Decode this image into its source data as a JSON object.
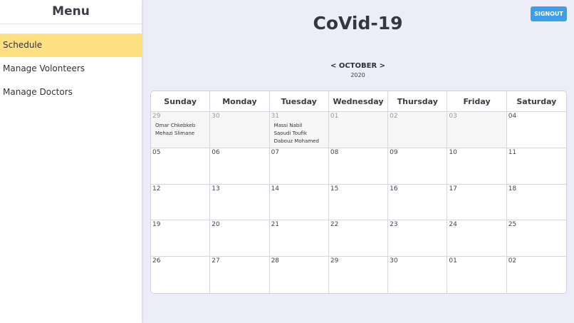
{
  "sidebar": {
    "title": "Menu",
    "items": [
      {
        "label": "Schedule",
        "active": true
      },
      {
        "label": "Manage Volonteers",
        "active": false
      },
      {
        "label": "Manage Doctors",
        "active": false
      }
    ]
  },
  "header": {
    "title": "CoVid-19",
    "signout_label": "SIGNOUT"
  },
  "calendar": {
    "prev_symbol": "<",
    "next_symbol": ">",
    "month": "OCTOBER",
    "year": "2020",
    "weekdays": [
      "Sunday",
      "Monday",
      "Tuesday",
      "Wednesday",
      "Thursday",
      "Friday",
      "Saturday"
    ],
    "weeks": [
      [
        {
          "day": "29",
          "other": true,
          "events": [
            "Omar Chkebkeb",
            "Mehazi Slimane"
          ]
        },
        {
          "day": "30",
          "other": true,
          "events": []
        },
        {
          "day": "31",
          "other": true,
          "events": [
            "Massi Nabil",
            "Saoudi Toufik",
            "Dabouz Mohamed"
          ]
        },
        {
          "day": "01",
          "other": true,
          "events": []
        },
        {
          "day": "02",
          "other": true,
          "events": []
        },
        {
          "day": "03",
          "other": true,
          "events": []
        },
        {
          "day": "04",
          "other": false,
          "events": []
        }
      ],
      [
        {
          "day": "05",
          "other": false,
          "events": []
        },
        {
          "day": "06",
          "other": false,
          "events": []
        },
        {
          "day": "07",
          "other": false,
          "events": []
        },
        {
          "day": "08",
          "other": false,
          "events": []
        },
        {
          "day": "09",
          "other": false,
          "events": []
        },
        {
          "day": "10",
          "other": false,
          "events": []
        },
        {
          "day": "11",
          "other": false,
          "events": []
        }
      ],
      [
        {
          "day": "12",
          "other": false,
          "events": []
        },
        {
          "day": "13",
          "other": false,
          "events": []
        },
        {
          "day": "14",
          "other": false,
          "events": []
        },
        {
          "day": "15",
          "other": false,
          "events": []
        },
        {
          "day": "16",
          "other": false,
          "events": []
        },
        {
          "day": "17",
          "other": false,
          "events": []
        },
        {
          "day": "18",
          "other": false,
          "events": []
        }
      ],
      [
        {
          "day": "19",
          "other": false,
          "events": []
        },
        {
          "day": "20",
          "other": false,
          "events": []
        },
        {
          "day": "21",
          "other": false,
          "events": []
        },
        {
          "day": "22",
          "other": false,
          "events": []
        },
        {
          "day": "23",
          "other": false,
          "events": []
        },
        {
          "day": "24",
          "other": false,
          "events": []
        },
        {
          "day": "25",
          "other": false,
          "events": []
        }
      ],
      [
        {
          "day": "26",
          "other": false,
          "events": []
        },
        {
          "day": "27",
          "other": false,
          "events": []
        },
        {
          "day": "28",
          "other": false,
          "events": []
        },
        {
          "day": "29",
          "other": false,
          "events": []
        },
        {
          "day": "30",
          "other": false,
          "events": []
        },
        {
          "day": "01",
          "other": false,
          "events": []
        },
        {
          "day": "02",
          "other": false,
          "events": []
        }
      ]
    ]
  },
  "colors": {
    "active_menu": "#ffe182",
    "signout_button": "#3d9fe9",
    "background": "#ecedf8"
  }
}
